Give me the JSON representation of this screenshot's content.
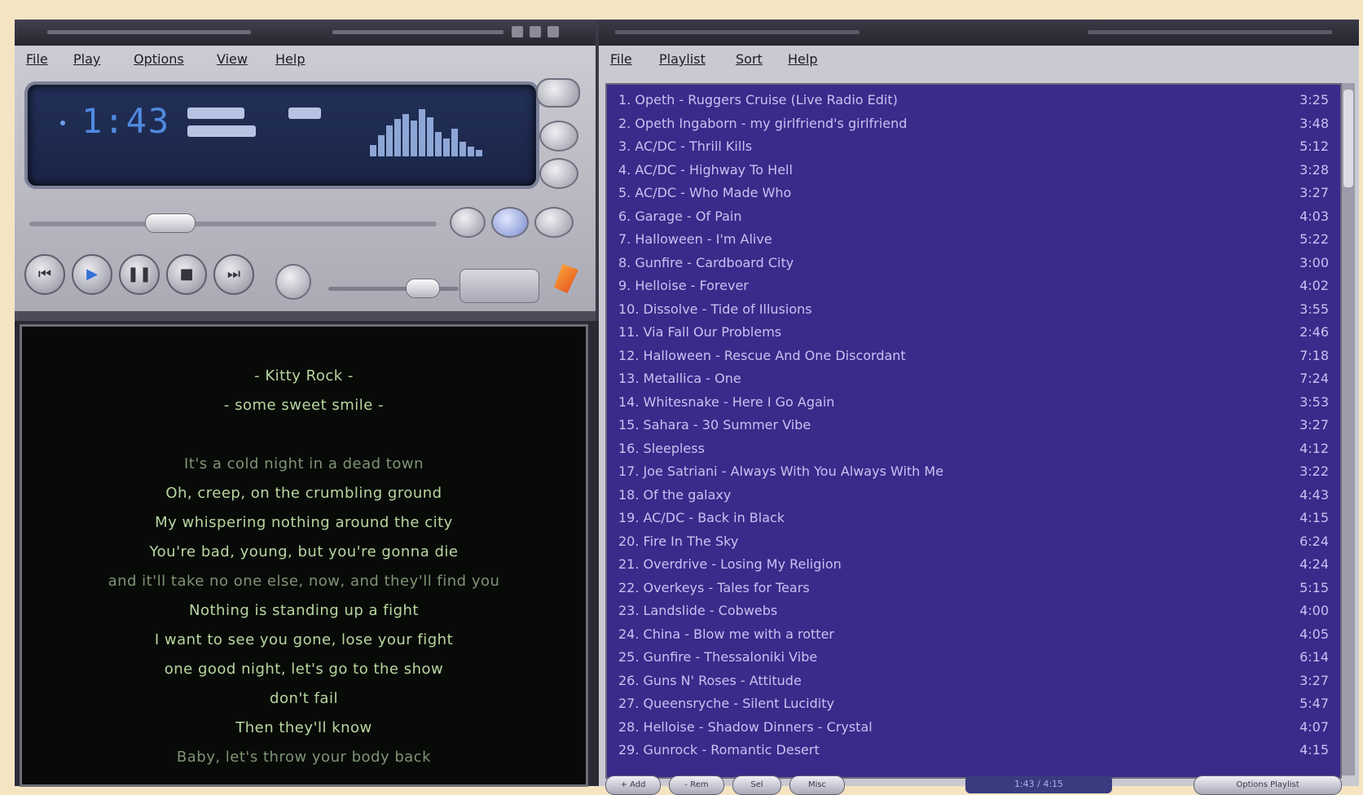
{
  "player": {
    "menu": [
      "File",
      "Play",
      "Options",
      "View",
      "Help"
    ],
    "time": "1:43"
  },
  "lyrics": {
    "lines": [
      "- Kitty Rock -",
      "- some sweet smile -",
      "",
      "It's a cold night in a dead town",
      "Oh, creep, on the crumbling ground",
      "My whispering nothing around the city",
      "You're bad, young, but you're gonna die",
      "and it'll take no one else, now, and they'll find you",
      "Nothing is standing up a fight",
      "I want to see you gone, lose your fight",
      "one good night, let's go to the show",
      "don't fail",
      "Then they'll know",
      "Baby, let's throw your body back"
    ]
  },
  "playlist": {
    "menu": [
      "File",
      "Playlist",
      "Sort",
      "Help"
    ],
    "items": [
      {
        "name": "1. Opeth - Ruggers Cruise (Live Radio Edit)",
        "dur": "3:25"
      },
      {
        "name": "2. Opeth Ingaborn - my girlfriend's girlfriend",
        "dur": "3:48"
      },
      {
        "name": "3. AC/DC - Thrill Kills",
        "dur": "5:12"
      },
      {
        "name": "4. AC/DC - Highway To Hell",
        "dur": "3:28"
      },
      {
        "name": "5. AC/DC - Who Made Who",
        "dur": "3:27"
      },
      {
        "name": "6. Garage - Of Pain",
        "dur": "4:03"
      },
      {
        "name": "7. Halloween - I'm Alive",
        "dur": "5:22"
      },
      {
        "name": "8. Gunfire - Cardboard City",
        "dur": "3:00"
      },
      {
        "name": "9. Helloise - Forever",
        "dur": "4:02"
      },
      {
        "name": "10. Dissolve - Tide of Illusions",
        "dur": "3:55"
      },
      {
        "name": "11. Via Fall Our Problems",
        "dur": "2:46"
      },
      {
        "name": "12. Halloween - Rescue And One Discordant",
        "dur": "7:18"
      },
      {
        "name": "13. Metallica - One",
        "dur": "7:24"
      },
      {
        "name": "14. Whitesnake - Here I Go Again",
        "dur": "3:53"
      },
      {
        "name": "15. Sahara - 30 Summer Vibe",
        "dur": "3:27"
      },
      {
        "name": "16. Sleepless",
        "dur": "4:12"
      },
      {
        "name": "17. Joe Satriani - Always With You Always With Me",
        "dur": "3:22"
      },
      {
        "name": "18. Of the galaxy",
        "dur": "4:43"
      },
      {
        "name": "19. AC/DC - Back in Black",
        "dur": "4:15"
      },
      {
        "name": "20. Fire In The Sky",
        "dur": "6:24"
      },
      {
        "name": "21. Overdrive - Losing My Religion",
        "dur": "4:24"
      },
      {
        "name": "22. Overkeys - Tales for Tears",
        "dur": "5:15"
      },
      {
        "name": "23. Landslide - Cobwebs",
        "dur": "4:00"
      },
      {
        "name": "24. China - Blow me with a rotter",
        "dur": "4:05"
      },
      {
        "name": "25. Gunfire - Thessaloniki Vibe",
        "dur": "6:14"
      },
      {
        "name": "26. Guns N' Roses - Attitude",
        "dur": "3:27"
      },
      {
        "name": "27. Queensryche - Silent Lucidity",
        "dur": "5:47"
      },
      {
        "name": "28. Helloise - Shadow Dinners - Crystal",
        "dur": "4:07"
      },
      {
        "name": "29. Gunrock - Romantic Desert",
        "dur": "4:15"
      }
    ],
    "buttons": [
      "+ Add",
      "- Rem",
      "Sel",
      "Misc"
    ],
    "info": "1:43 / 4:15",
    "list_button": "Options   Playlist"
  }
}
